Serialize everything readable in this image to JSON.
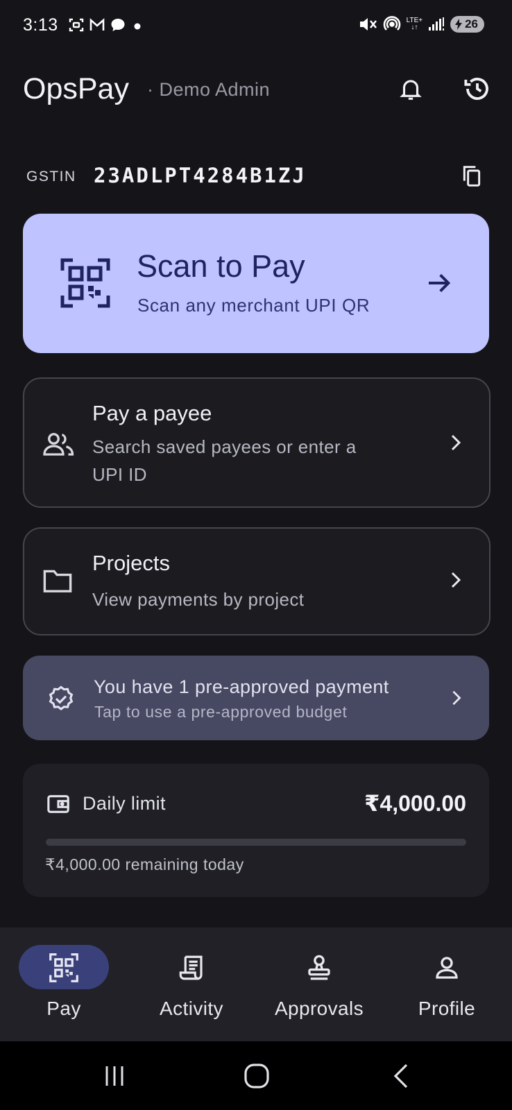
{
  "status_bar": {
    "time": "3:13",
    "lte_label": "LTE+",
    "battery_level": "26",
    "icons": [
      "screenshot-icon",
      "gmail-icon",
      "chat-icon",
      "dot-icon",
      "mute-icon",
      "hotspot-icon",
      "signal-icon",
      "battery-charging-icon"
    ]
  },
  "header": {
    "app_name": "OpsPay",
    "subtitle": "· Demo Admin",
    "icons": [
      "bell-icon",
      "history-icon"
    ]
  },
  "gstin": {
    "label": "GSTIN",
    "value": "23ADLPT4284B1ZJ"
  },
  "scan_card": {
    "title": "Scan to Pay",
    "subtitle": "Scan any merchant UPI QR"
  },
  "pay_payee": {
    "title": "Pay a payee",
    "subtitle_line1": "Search saved payees or enter a",
    "subtitle_line2": "UPI ID"
  },
  "projects": {
    "title": "Projects",
    "subtitle": "View payments by project"
  },
  "preapproved": {
    "title": "You have 1 pre-approved payment",
    "subtitle": "Tap to use a pre-approved budget"
  },
  "daily_limit": {
    "label": "Daily limit",
    "amount": "₹4,000.00",
    "remaining": "₹4,000.00 remaining today",
    "used_fraction": 0
  },
  "bottom_nav": {
    "items": [
      {
        "label": "Pay",
        "icon": "qr-icon",
        "active": true
      },
      {
        "label": "Activity",
        "icon": "receipt-icon",
        "active": false
      },
      {
        "label": "Approvals",
        "icon": "stamp-icon",
        "active": false
      },
      {
        "label": "Profile",
        "icon": "person-icon",
        "active": false
      }
    ]
  },
  "colors": {
    "background": "#151519",
    "accent_card": "#bfc3ff",
    "accent_text": "#1e2460",
    "preapproved_bg": "#474862",
    "nav_active_pill": "#3a4079"
  }
}
